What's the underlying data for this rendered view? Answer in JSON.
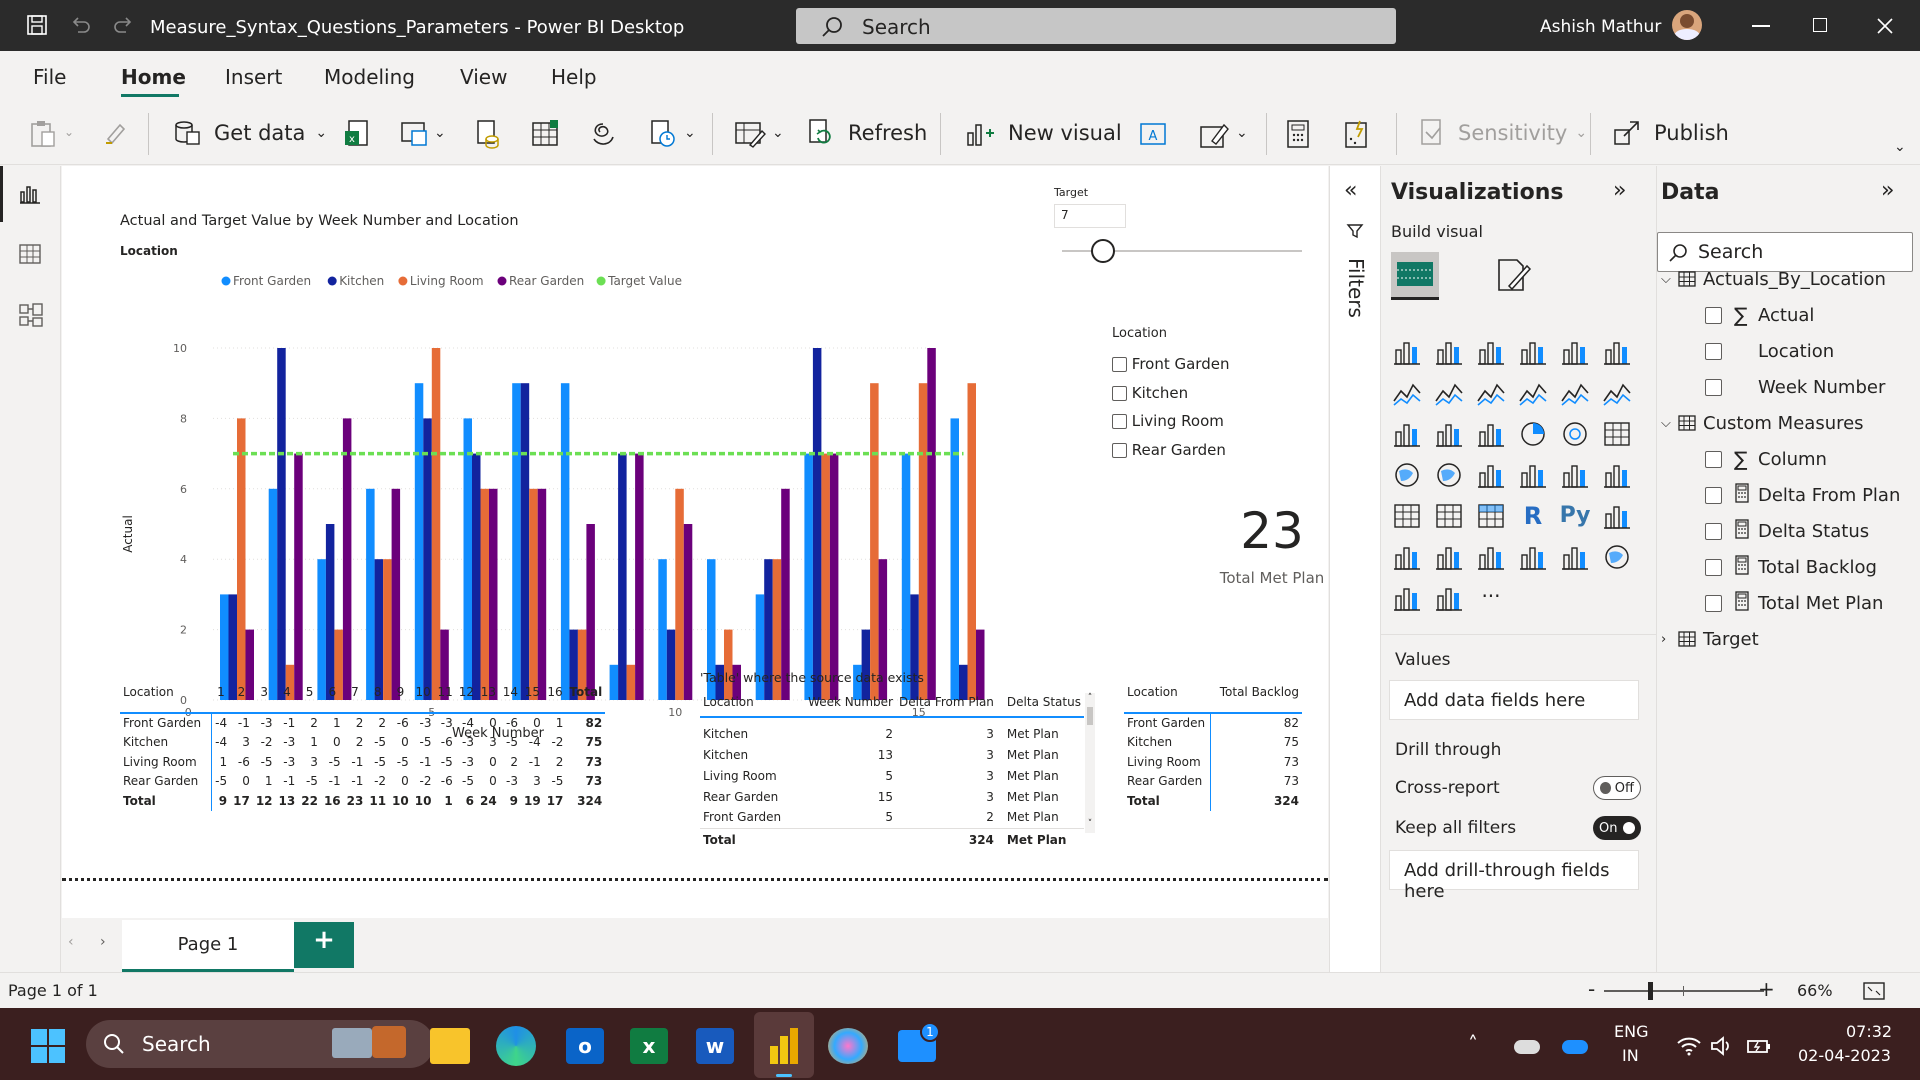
{
  "titlebar": {
    "title": "Measure_Syntax_Questions_Parameters - Power BI Desktop",
    "search_placeholder": "Search",
    "user_name": "Ashish Mathur"
  },
  "menu": [
    "File",
    "Home",
    "Insert",
    "Modeling",
    "View",
    "Help"
  ],
  "ribbon": {
    "get_data": "Get data",
    "refresh": "Refresh",
    "new_visual": "New visual",
    "sensitivity": "Sensitivity",
    "publish": "Publish"
  },
  "chart": {
    "title": "Actual and Target Value by Week Number and Location",
    "legend_label": "Location"
  },
  "chart_data": {
    "type": "bar",
    "title": "Actual and Target Value by Week Number and Location",
    "xlabel": "Week Number",
    "ylabel": "Actual",
    "xticks": [
      "0",
      "5",
      "10",
      "15"
    ],
    "yticks": [
      "0",
      "2",
      "4",
      "6",
      "8",
      "10"
    ],
    "ylim": [
      0,
      10
    ],
    "categories": [
      1,
      2,
      3,
      4,
      5,
      6,
      7,
      8,
      9,
      10,
      11,
      12,
      13,
      14,
      15,
      16
    ],
    "series": [
      {
        "name": "Front Garden",
        "color": "#118dff",
        "values": [
          3,
          6,
          4,
          6,
          9,
          8,
          9,
          9,
          1,
          4,
          4,
          3,
          7,
          1,
          7,
          8
        ]
      },
      {
        "name": "Kitchen",
        "color": "#12239e",
        "values": [
          3,
          10,
          5,
          4,
          8,
          7,
          9,
          2,
          7,
          2,
          1,
          4,
          10,
          2,
          3,
          1
        ]
      },
      {
        "name": "Living Room",
        "color": "#e66c37",
        "values": [
          8,
          1,
          2,
          4,
          10,
          6,
          6,
          2,
          1,
          6,
          2,
          4,
          7,
          9,
          9,
          9
        ]
      },
      {
        "name": "Rear Garden",
        "color": "#6b007b",
        "values": [
          2,
          7,
          8,
          6,
          2,
          6,
          6,
          5,
          7,
          5,
          1,
          6,
          7,
          4,
          10,
          2
        ]
      },
      {
        "name": "Target Value",
        "color": "#6cdf54",
        "values": [
          7,
          7,
          7,
          7,
          7,
          7,
          7,
          7,
          7,
          7,
          7,
          7,
          7,
          7,
          7,
          7
        ]
      }
    ],
    "legend": "top-left"
  },
  "slicer": {
    "title": "Target",
    "value": "7",
    "location_title": "Location",
    "items": [
      "Front Garden",
      "Kitchen",
      "Living Room",
      "Rear Garden"
    ]
  },
  "card": {
    "value": "23",
    "label": "Total Met Plan"
  },
  "matrix": {
    "headers": [
      "Location",
      "1",
      "2",
      "3",
      "4",
      "5",
      "6",
      "7",
      "8",
      "9",
      "10",
      "11",
      "12",
      "13",
      "14",
      "15",
      "16",
      "Total"
    ],
    "rows": [
      [
        "Front Garden",
        "-4",
        "-1",
        "-3",
        "-1",
        "2",
        "1",
        "2",
        "2",
        "-6",
        "-3",
        "-3",
        "-4",
        "0",
        "-6",
        "0",
        "1",
        "82"
      ],
      [
        "Kitchen",
        "-4",
        "3",
        "-2",
        "-3",
        "1",
        "0",
        "2",
        "-5",
        "0",
        "-5",
        "-6",
        "-3",
        "3",
        "-5",
        "-4",
        "-2",
        "75"
      ],
      [
        "Living Room",
        "1",
        "-6",
        "-5",
        "-3",
        "3",
        "-5",
        "-1",
        "-5",
        "-5",
        "-1",
        "-5",
        "-3",
        "0",
        "2",
        "-1",
        "2",
        "73"
      ],
      [
        "Rear Garden",
        "-5",
        "0",
        "1",
        "-1",
        "-5",
        "-1",
        "-1",
        "-2",
        "0",
        "-2",
        "-6",
        "-5",
        "0",
        "-3",
        "3",
        "-5",
        "73"
      ]
    ],
    "total": [
      "Total",
      "9",
      "17",
      "12",
      "13",
      "22",
      "16",
      "23",
      "11",
      "10",
      "10",
      "1",
      "6",
      "24",
      "9",
      "19",
      "17",
      "324"
    ]
  },
  "srctable": {
    "title": "'Table' where the source data exists",
    "headers": [
      "Location",
      "Week Number",
      "Delta From Plan",
      "Delta Status"
    ],
    "rows": [
      [
        "Kitchen",
        "2",
        "3",
        "Met Plan"
      ],
      [
        "Kitchen",
        "13",
        "3",
        "Met Plan"
      ],
      [
        "Living Room",
        "5",
        "3",
        "Met Plan"
      ],
      [
        "Rear Garden",
        "15",
        "3",
        "Met Plan"
      ],
      [
        "Front Garden",
        "5",
        "2",
        "Met Plan"
      ]
    ],
    "total": [
      "Total",
      "",
      "324",
      "Met Plan"
    ]
  },
  "backlog": {
    "headers": [
      "Location",
      "Total Backlog"
    ],
    "rows": [
      [
        "Front Garden",
        "82"
      ],
      [
        "Kitchen",
        "75"
      ],
      [
        "Living Room",
        "73"
      ],
      [
        "Rear Garden",
        "73"
      ]
    ],
    "total": [
      "Total",
      "324"
    ]
  },
  "filters_label": "Filters",
  "viz": {
    "title": "Visualizations",
    "build_visual": "Build visual",
    "values": "Values",
    "add_data": "Add data fields here",
    "drill_through": "Drill through",
    "cross_report": "Cross-report",
    "off": "Off",
    "keep_filters": "Keep all filters",
    "on": "On",
    "add_drill": "Add drill-through fields here",
    "ellipsis": "···",
    "r_label": "R",
    "py_label": "Py"
  },
  "data": {
    "title": "Data",
    "search_placeholder": "Search",
    "tables": [
      {
        "name": "Actuals_By_Location",
        "fields": [
          "Actual",
          "Location",
          "Week Number"
        ]
      },
      {
        "name": "Custom Measures",
        "fields": [
          "Column",
          "Delta From Plan",
          "Delta Status",
          "Total Backlog",
          "Total Met Plan"
        ]
      },
      {
        "name": "Target",
        "fields": []
      }
    ]
  },
  "pages": {
    "page1": "Page 1",
    "add": "+"
  },
  "status": {
    "page_info": "Page 1 of 1",
    "zoom": "66%",
    "minus": "-",
    "plus": "+"
  },
  "taskbar": {
    "search": "Search",
    "lang1": "ENG",
    "lang2": "IN",
    "time": "07:32",
    "date": "02-04-2023",
    "badge": "1"
  }
}
